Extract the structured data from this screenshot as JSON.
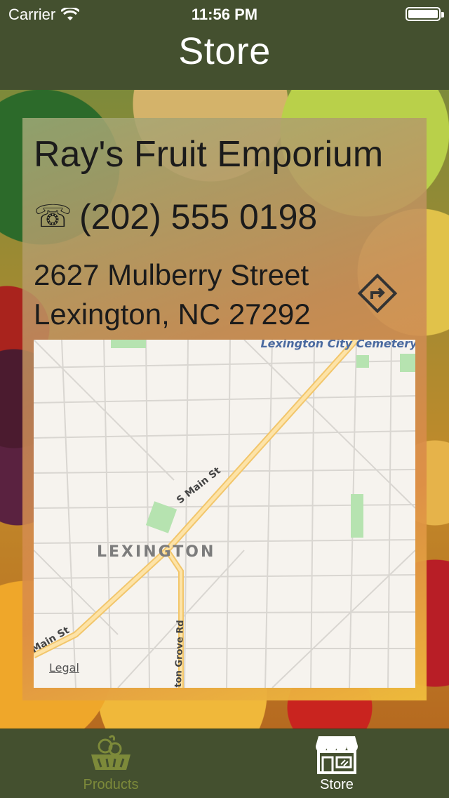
{
  "status_bar": {
    "carrier": "Carrier",
    "time": "11:56 PM",
    "battery_level": 1.0
  },
  "nav": {
    "title": "Store"
  },
  "store": {
    "name": "Ray's Fruit Emporium",
    "phone": "(202) 555 0198",
    "phone_icon": "☏",
    "address_line1": "2627 Mulberry Street",
    "address_line2": "Lexington, NC 27292",
    "directions_icon": "directions-icon"
  },
  "map": {
    "cemetery_label": "Lexington City Cemetery",
    "city_label": "LEXINGTON",
    "road_main_upper": "S Main St",
    "road_main_lower": "Main St",
    "road_grove": "ton Grove Rd",
    "legal_link": "Legal",
    "colors": {
      "land": "#f6f3ee",
      "road_major": "#f7d17a",
      "park": "#b6e3b0",
      "street": "#d9d6d1"
    }
  },
  "tabbar": {
    "items": [
      {
        "label": "Products",
        "icon": "fruit-basket-icon",
        "selected": false
      },
      {
        "label": "Store",
        "icon": "storefront-icon",
        "selected": true
      }
    ],
    "colors": {
      "active": "#ffffff",
      "inactive": "#7d8a3a",
      "background": "#44502f"
    }
  }
}
